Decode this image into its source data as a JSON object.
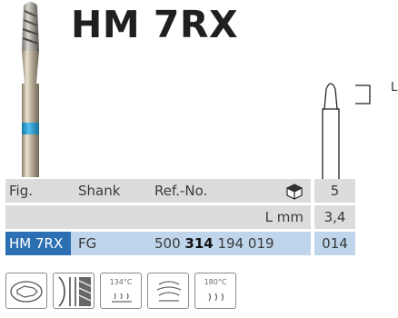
{
  "product": {
    "code": "HM 7RX"
  },
  "dimension_label": "L",
  "table": {
    "header": {
      "fig": "Fig.",
      "shank": "Shank",
      "ref": "Ref.-No.",
      "pack_icon": "package-box-icon",
      "value": "5"
    },
    "length_row": {
      "label": "L mm",
      "value": "3,4"
    },
    "item_row": {
      "fig": "HM 7RX",
      "shank": "FG",
      "ref_part1": "500",
      "ref_part2": "314",
      "ref_part3": "194 019",
      "size": "014"
    }
  },
  "symbols": [
    {
      "name": "contra-angle-icon"
    },
    {
      "name": "crosscut-icon"
    },
    {
      "name": "thermodisinfector-icon",
      "text": "134°C"
    },
    {
      "name": "ultrasonic-cleaning-icon"
    },
    {
      "name": "sterilizer-icon",
      "text": "180°C"
    }
  ],
  "colors": {
    "title": "#1f1f1f",
    "row_gray": "#dcdcdc",
    "row_blue": "#bfd5ec",
    "selected": "#2d6fb3",
    "band": "#2fa4dc"
  }
}
